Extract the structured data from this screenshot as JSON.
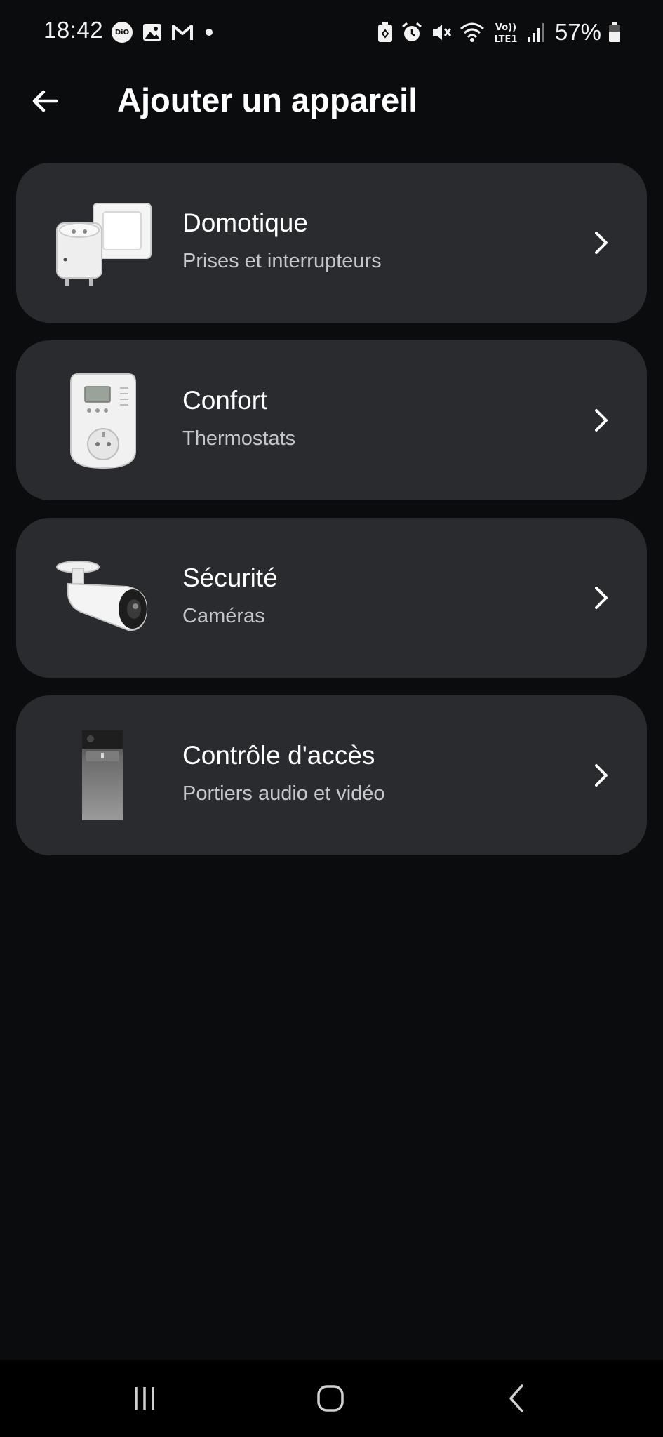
{
  "status_bar": {
    "time": "18:42",
    "battery_percent": "57%",
    "left_icons": [
      "dio-app-icon",
      "gallery-icon",
      "gmail-icon",
      "dot-icon"
    ],
    "right_icons": [
      "battery-saver-icon",
      "alarm-icon",
      "mute-icon",
      "wifi-icon",
      "volte-lte-icon",
      "signal-icon",
      "battery-icon"
    ],
    "volte_label": "Vo))",
    "lte_label": "LTE1"
  },
  "header": {
    "title": "Ajouter un appareil",
    "back_icon": "arrow-left-icon"
  },
  "categories": [
    {
      "title": "Domotique",
      "subtitle": "Prises et interrupteurs",
      "image": "smart-plug-switch-image"
    },
    {
      "title": "Confort",
      "subtitle": "Thermostats",
      "image": "thermostat-image"
    },
    {
      "title": "Sécurité",
      "subtitle": "Caméras",
      "image": "camera-image"
    },
    {
      "title": "Contrôle d'accès",
      "subtitle": "Portiers audio et vidéo",
      "image": "doorbell-image"
    }
  ],
  "nav_bar": {
    "icons": [
      "recent-apps-icon",
      "home-icon",
      "back-icon"
    ]
  },
  "colors": {
    "background": "#0b0c0e",
    "card": "#2a2b2e",
    "text_primary": "#ffffff",
    "text_secondary": "#c6c7c9"
  }
}
